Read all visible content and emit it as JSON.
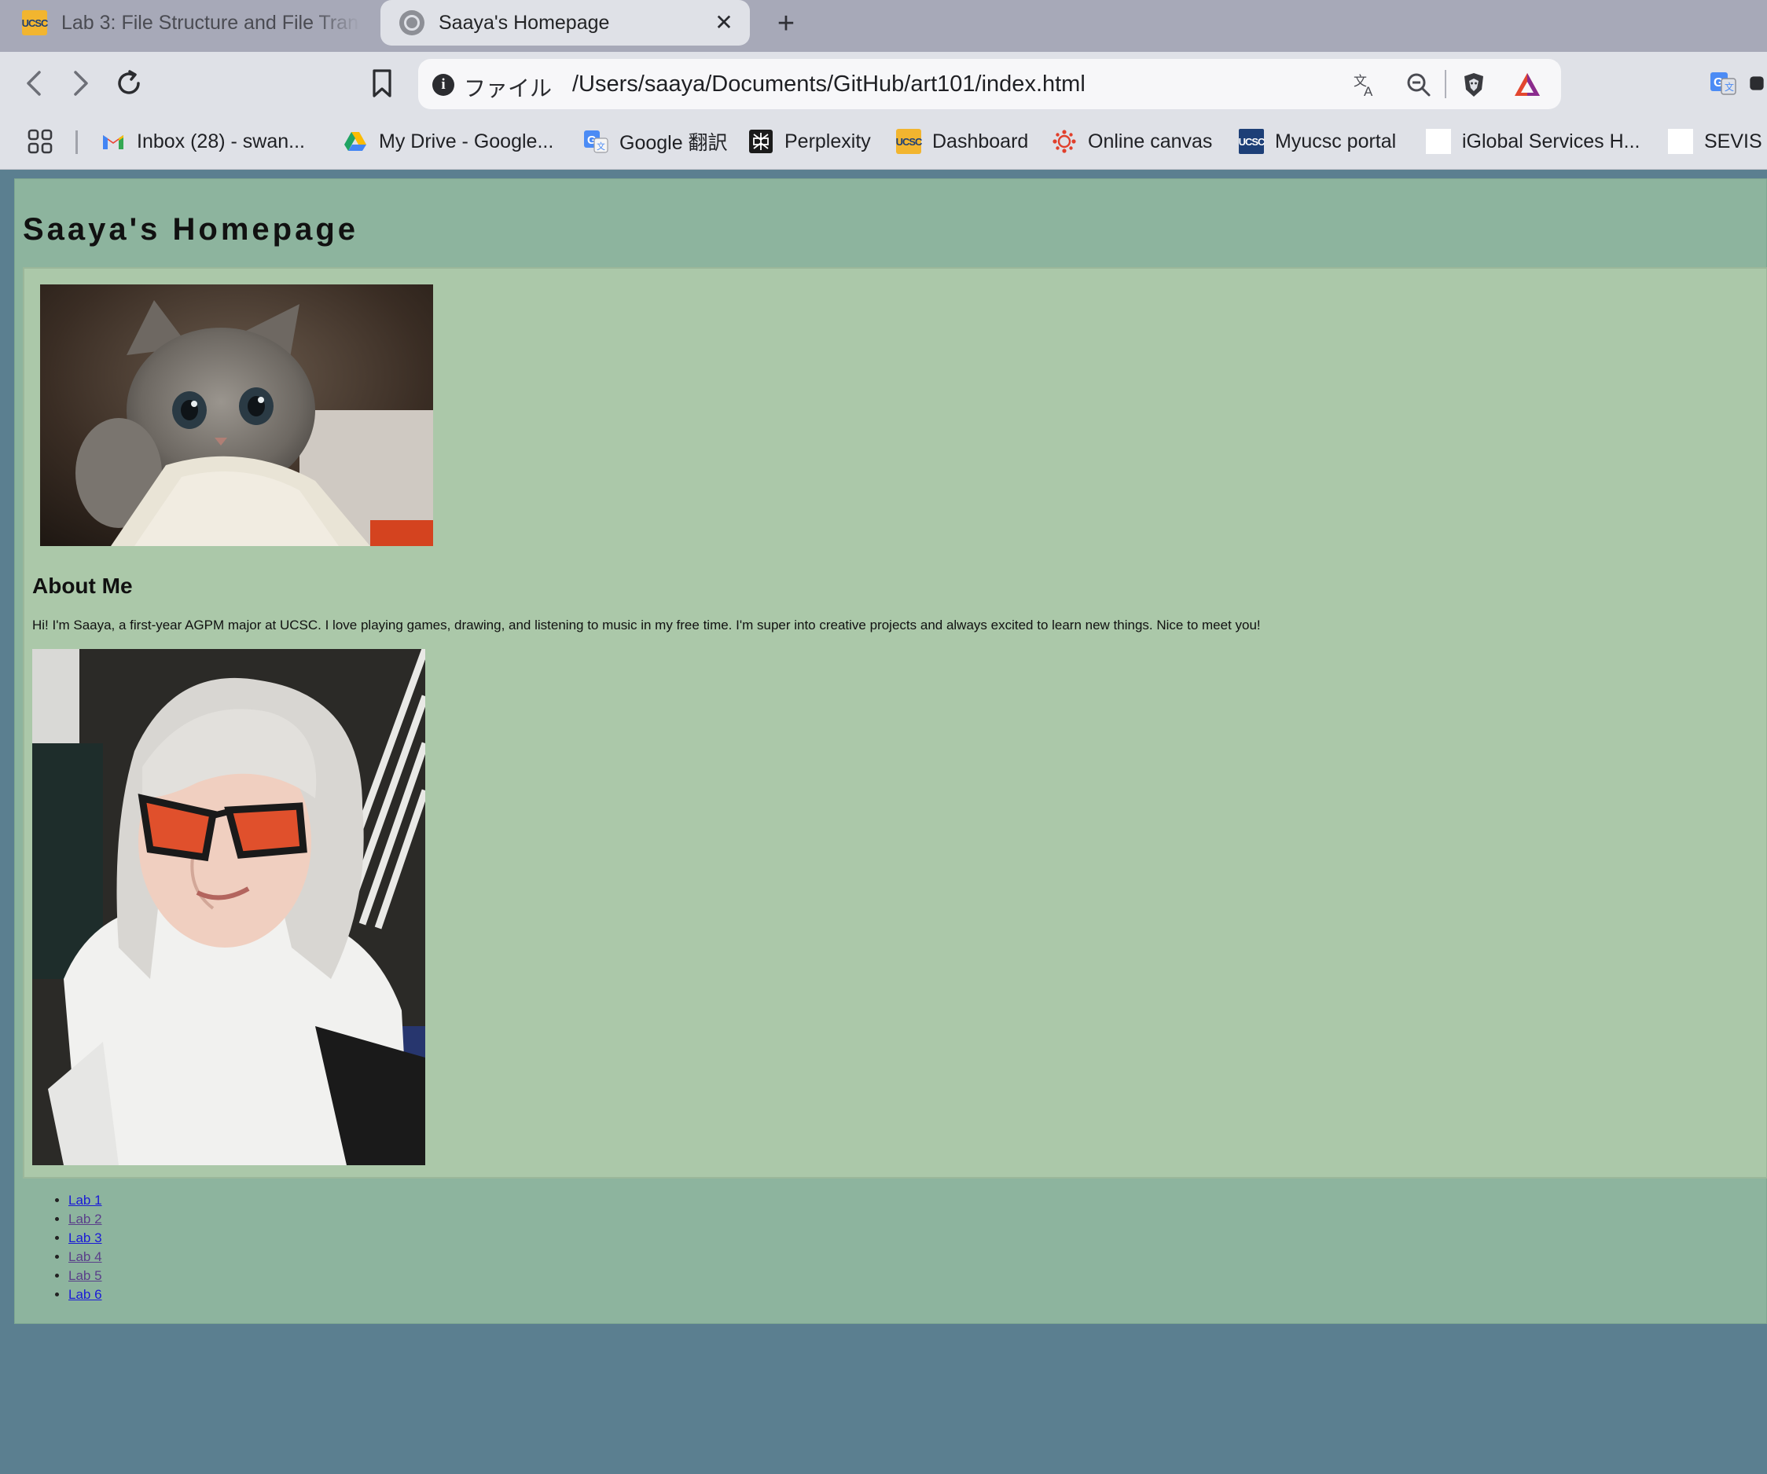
{
  "browser": {
    "tabs": [
      {
        "label": "Lab 3: File Structure and File Tran",
        "favicon": "ucsc-icon",
        "active": false
      },
      {
        "label": "Saaya's Homepage",
        "favicon": "globe-icon",
        "active": true
      }
    ],
    "new_tab_icon": "plus-icon",
    "close_tab_icon": "close-icon",
    "address_bar": {
      "scheme_label": "ファイル",
      "url": "/Users/saaya/Documents/GitHub/art101/index.html",
      "icons": [
        "info-icon",
        "translate-icon",
        "zoom-out-icon",
        "brave-shields-icon",
        "brave-rewards-icon"
      ]
    },
    "bookmarks": [
      {
        "label": "Inbox (28) - swan...",
        "icon": "gmail-icon"
      },
      {
        "label": "My Drive - Google...",
        "icon": "google-drive-icon"
      },
      {
        "label": "Google 翻訳",
        "icon": "google-translate-icon"
      },
      {
        "label": "Perplexity",
        "icon": "perplexity-icon"
      },
      {
        "label": "Dashboard",
        "icon": "ucsc-icon"
      },
      {
        "label": "Online canvas",
        "icon": "canvas-icon"
      },
      {
        "label": "Myucsc portal",
        "icon": "ucsc-icon"
      },
      {
        "label": "iGlobal Services H...",
        "icon": "blank-page-icon"
      },
      {
        "label": "SEVIS I",
        "icon": "blank-page-icon"
      }
    ]
  },
  "page": {
    "title": "Saaya's Homepage",
    "about_heading": "About Me",
    "about_text": "Hi! I'm Saaya, a first-year AGPM major at UCSC. I love playing games, drawing, and listening to music in my free time. I'm super into creative projects and always excited to learn new things. Nice to meet you!",
    "labs": [
      "Lab 1",
      "Lab 2",
      "Lab 3",
      "Lab 4",
      "Lab 5",
      "Lab 6"
    ],
    "colors": {
      "page_background": "#8db49e",
      "content_background": "#abc8a9",
      "outer_background": "#5b7f90",
      "link": "#1a1ad6",
      "visited_link": "#5a3f8a"
    }
  }
}
